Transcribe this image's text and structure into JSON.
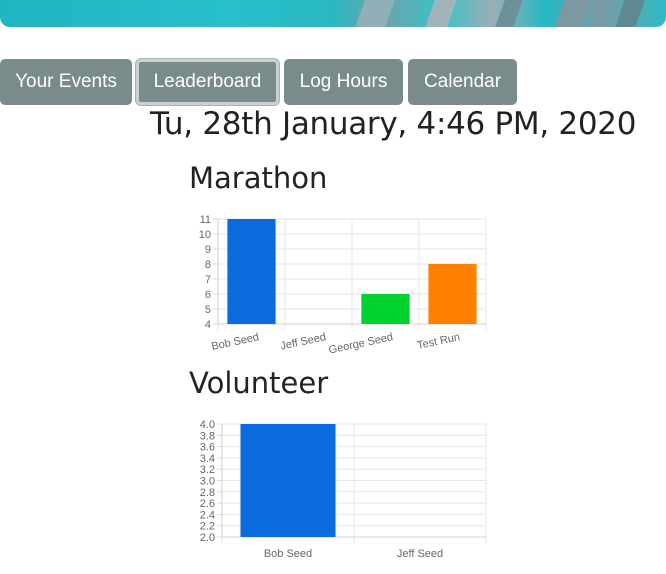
{
  "nav": {
    "items": [
      {
        "label": "Your Events",
        "active": false
      },
      {
        "label": "Leaderboard",
        "active": true
      },
      {
        "label": "Log Hours",
        "active": false
      },
      {
        "label": "Calendar",
        "active": false
      }
    ],
    "color": "#7a8b8b"
  },
  "header": {
    "datetime": "Tu, 28th January, 4:46 PM, 2020"
  },
  "charts": {
    "marathon_title": "Marathon",
    "volunteer_title": "Volunteer"
  },
  "chart_data": [
    {
      "type": "bar",
      "title": "Marathon",
      "categories": [
        "Bob Seed",
        "Jeff Seed",
        "George Seed",
        "Test Run"
      ],
      "values": [
        11,
        null,
        6,
        8
      ],
      "colors": [
        "#0a6bde",
        "#0a6bde",
        "#00d22e",
        "#ff7f00"
      ],
      "ylim": [
        4,
        11
      ],
      "yticks": [
        4,
        5,
        6,
        7,
        8,
        9,
        10,
        11
      ],
      "grid": true,
      "xlabel_rotated": true
    },
    {
      "type": "bar",
      "title": "Volunteer",
      "categories": [
        "Bob Seed",
        "Jeff Seed"
      ],
      "values": [
        4.0,
        null
      ],
      "colors": [
        "#0a6bde",
        "#0a6bde"
      ],
      "ylim": [
        2.0,
        4.0
      ],
      "yticks": [
        "2.0",
        "2.2",
        "2.4",
        "2.6",
        "2.8",
        "3.0",
        "3.2",
        "3.4",
        "3.6",
        "3.8",
        "4.0"
      ],
      "grid": true,
      "xlabel_rotated": false
    }
  ]
}
